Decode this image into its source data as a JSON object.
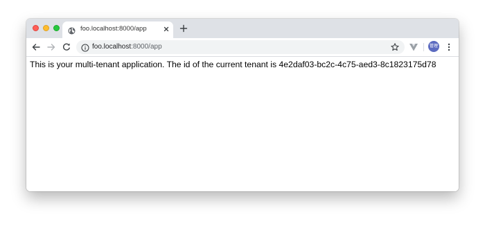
{
  "colors": {
    "tabstrip_bg": "#dee1e6",
    "omnibox_bg": "#f1f3f4",
    "traffic_close": "#ff5f57",
    "traffic_minimize": "#febc2e",
    "traffic_maximize": "#28c840",
    "avatar_bg": "#5c6bc0"
  },
  "browser": {
    "tab": {
      "title": "foo.localhost:8000/app",
      "favicon": "globe-icon",
      "close_icon": "close-icon"
    },
    "new_tab_icon": "plus-icon",
    "nav": {
      "back_icon": "arrow-left-icon",
      "forward_icon": "arrow-right-icon",
      "reload_icon": "reload-icon"
    },
    "address_bar": {
      "security_icon": "info-icon",
      "host": "foo.localhost",
      "rest": ":8000/app",
      "bookmark_icon": "star-icon"
    },
    "extension_icon": "vue-devtools-icon",
    "avatar_label": "管理",
    "menu_icon": "kebab-menu-icon"
  },
  "page": {
    "message": "This is your multi-tenant application. The id of the current tenant is 4e2daf03-bc2c-4c75-aed3-8c1823175d78"
  }
}
